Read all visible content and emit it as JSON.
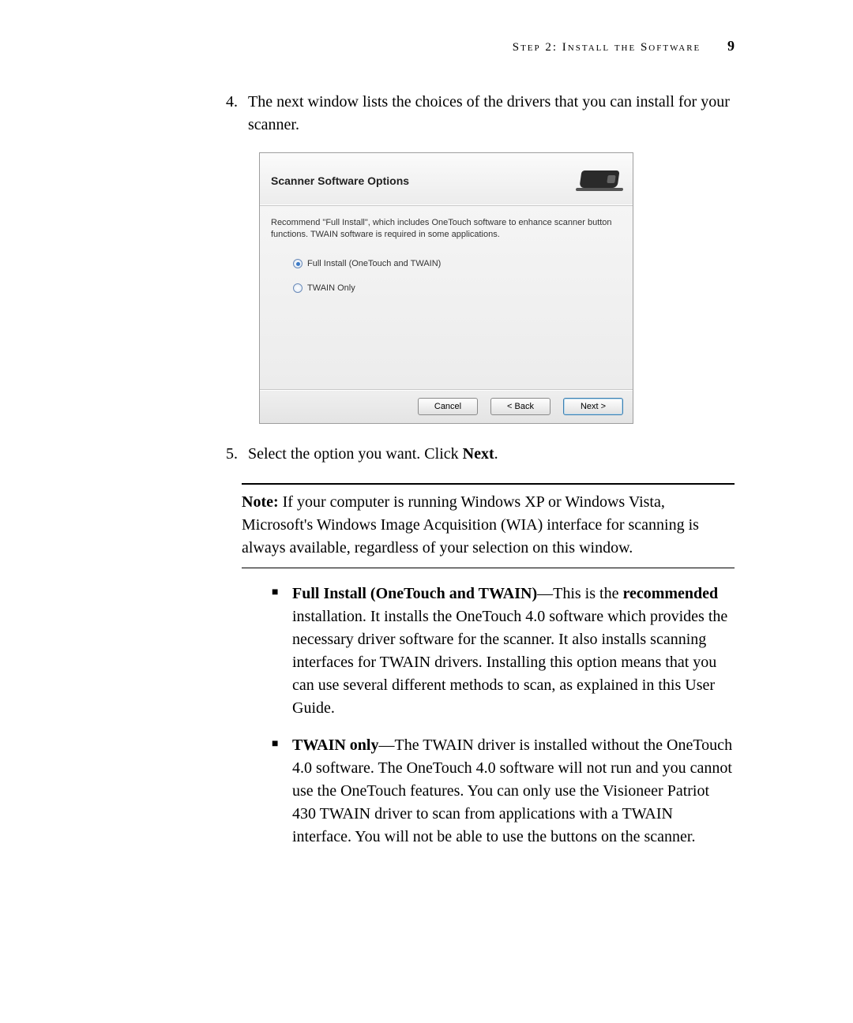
{
  "header": {
    "section": "Step 2: Install the Software",
    "page_number": "9"
  },
  "steps": {
    "start_number": 4,
    "item4": "The next window lists the choices of the drivers that you can install for your scanner.",
    "item5_pre": "Select the option you want. Click ",
    "item5_bold": "Next",
    "item5_post": "."
  },
  "dialog": {
    "title": "Scanner Software Options",
    "recommend": "Recommend \"Full Install\", which includes OneTouch software to enhance scanner button functions. TWAIN software is required in some applications.",
    "option1": "Full Install (OneTouch and TWAIN)",
    "option2": "TWAIN Only",
    "buttons": {
      "cancel": "Cancel",
      "back": "< Back",
      "next": "Next >"
    }
  },
  "note": {
    "label": "Note:",
    "text": " If your computer is running Windows XP or Windows Vista, Microsoft's Windows Image Acquisition (WIA) interface for scanning is always available, regardless of your selection on this window."
  },
  "bullets": {
    "b1_bold": "Full Install (OneTouch and TWAIN)",
    "b1_mid1": "—This is the ",
    "b1_bold2": "recommended",
    "b1_rest": " installation. It installs the OneTouch 4.0 software which provides the necessary driver software for the scanner. It also installs scanning interfaces for TWAIN drivers. Installing this option means that you can use several different methods to scan, as explained in this User Guide.",
    "b2_bold": "TWAIN only",
    "b2_rest": "—The TWAIN driver is installed without the OneTouch 4.0 software. The OneTouch 4.0 software will not run and you cannot use the OneTouch features. You can only use the Visioneer Patriot 430 TWAIN driver to scan from applications with a TWAIN interface. You will not be able to use the buttons on the scanner."
  }
}
